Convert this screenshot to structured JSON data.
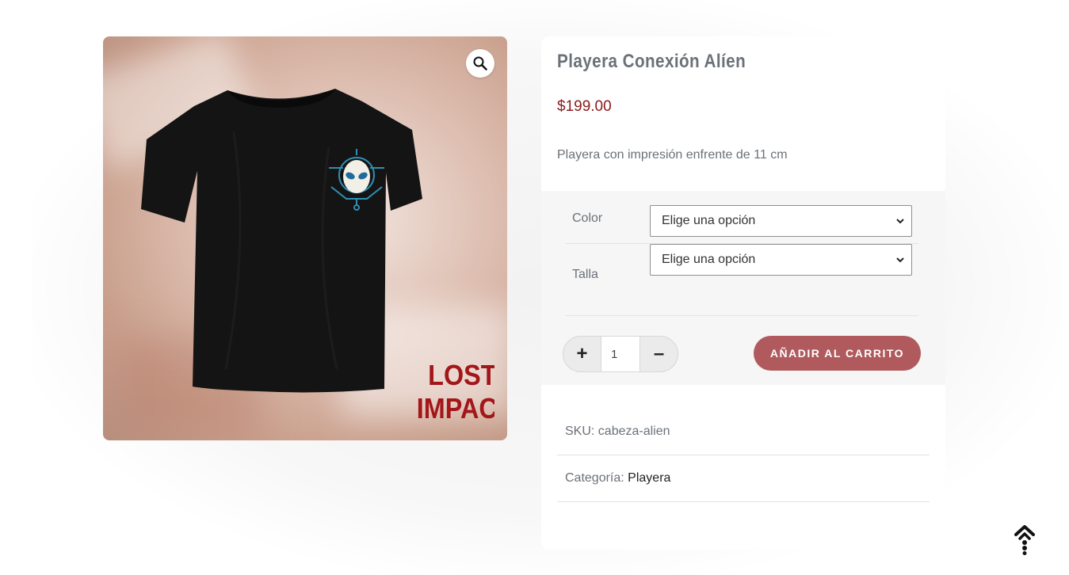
{
  "product": {
    "title": "Playera Conexión Alíen",
    "price": "$199.00",
    "description": "Playera con impresión enfrente de 11 cm",
    "image": {
      "brand_line1": "LOST",
      "brand_line2": "IMPACT",
      "zoom_icon": "magnifier-icon"
    }
  },
  "variations": {
    "color": {
      "label": "Color",
      "selected": "Elige una opción"
    },
    "talla": {
      "label": "Talla",
      "selected": "Elige una opción"
    }
  },
  "cart": {
    "plus_label": "+",
    "minus_label": "–",
    "quantity": "1",
    "add_to_cart_label": "AÑADIR AL CARRITO"
  },
  "meta": {
    "sku_label": "SKU:",
    "sku_value": "cabeza-alien",
    "category_label": "Categoría:",
    "category_value": "Playera"
  },
  "colors": {
    "price": "#8b1a1a",
    "button": "#b05a5e",
    "text_muted": "#6b7178",
    "brand": "#a3161a"
  }
}
